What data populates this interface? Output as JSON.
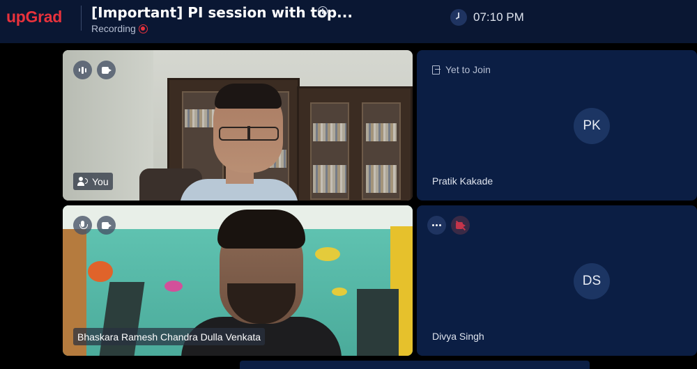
{
  "header": {
    "brand": "upGrad",
    "meeting_title": "[Important] PI session with top...",
    "recording_label": "Recording",
    "time": "07:10 PM"
  },
  "tiles": {
    "self": {
      "name": "You"
    },
    "bhaskara": {
      "name": "Bhaskara Ramesh Chandra Dulla Venkata"
    },
    "pratik": {
      "status": "Yet to Join",
      "initials": "PK",
      "name": "Pratik Kakade"
    },
    "divya": {
      "initials": "DS",
      "name": "Divya Singh"
    }
  },
  "icons": {
    "recording": "recording-dot-icon",
    "clock": "clock-icon",
    "info": "info-icon",
    "audio_level": "audio-level-icon",
    "camera": "camera-icon",
    "microphone": "microphone-icon",
    "camera_off": "camera-off-icon",
    "more": "more-options-icon",
    "speaker": "speaker-icon",
    "join": "yet-to-join-icon"
  },
  "colors": {
    "brand": "#e8323c",
    "header_bg": "#0a1733",
    "tile_bg": "#0b1e44",
    "avatar_bg": "#1c3563"
  }
}
